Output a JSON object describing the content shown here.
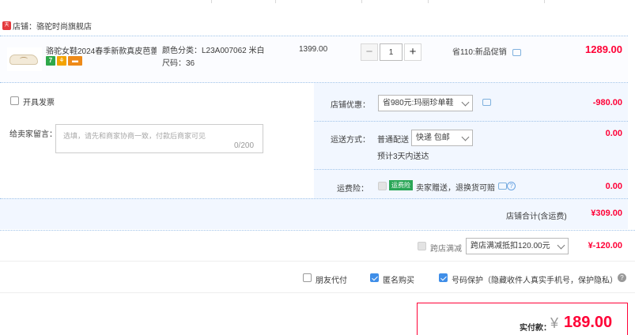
{
  "store": {
    "tag": "天猫",
    "name_label": "店铺：",
    "name": "骆驼时尚旗舰店"
  },
  "item": {
    "title": "骆驼女鞋2024春季新款真皮芭蕾...",
    "badges": [
      "7",
      "⚘",
      "▬"
    ],
    "sku_color": "颜色分类：L23A007062 米白",
    "sku_size": "尺码：36",
    "price": "1399.00",
    "quantity": "1",
    "promo": "省110:新品促销",
    "subtotal": "1289.00"
  },
  "invoice": {
    "label": "开具发票"
  },
  "message": {
    "label": "给卖家留言：",
    "placeholder": "选填，请先和商家协商一致，付款后商家可见",
    "count": "0/200"
  },
  "shop_discount": {
    "label": "店铺优惠：",
    "selected": "省980元:玛丽珍单鞋",
    "amount": "-980.00"
  },
  "shipping": {
    "label": "运送方式：",
    "method": "普通配送",
    "selected": "快递 包邮",
    "eta": "预计3天内送达",
    "amount": "0.00"
  },
  "insurance": {
    "label": "运费险：",
    "tag": "运费险",
    "text": "卖家赠送，退换货可赔",
    "help": "?",
    "amount": "0.00"
  },
  "store_total": {
    "label": "店铺合计(含运费)",
    "amount": "¥309.00"
  },
  "cross_store": {
    "label": "跨店满减",
    "selected": "跨店满减抵扣120.00元",
    "amount": "¥-120.00"
  },
  "options": {
    "friend_pay": "朋友代付",
    "anonymous": "匿名购买",
    "privacy": "号码保护（隐藏收件人真实手机号，保护隐私）",
    "help": "?"
  },
  "payment": {
    "label": "实付款：",
    "currency": "¥",
    "amount": "189.00"
  },
  "colors": {
    "accent_red": "#ff0036",
    "link_blue": "#3f8ee8",
    "panel_bg": "#f2f7ff"
  }
}
